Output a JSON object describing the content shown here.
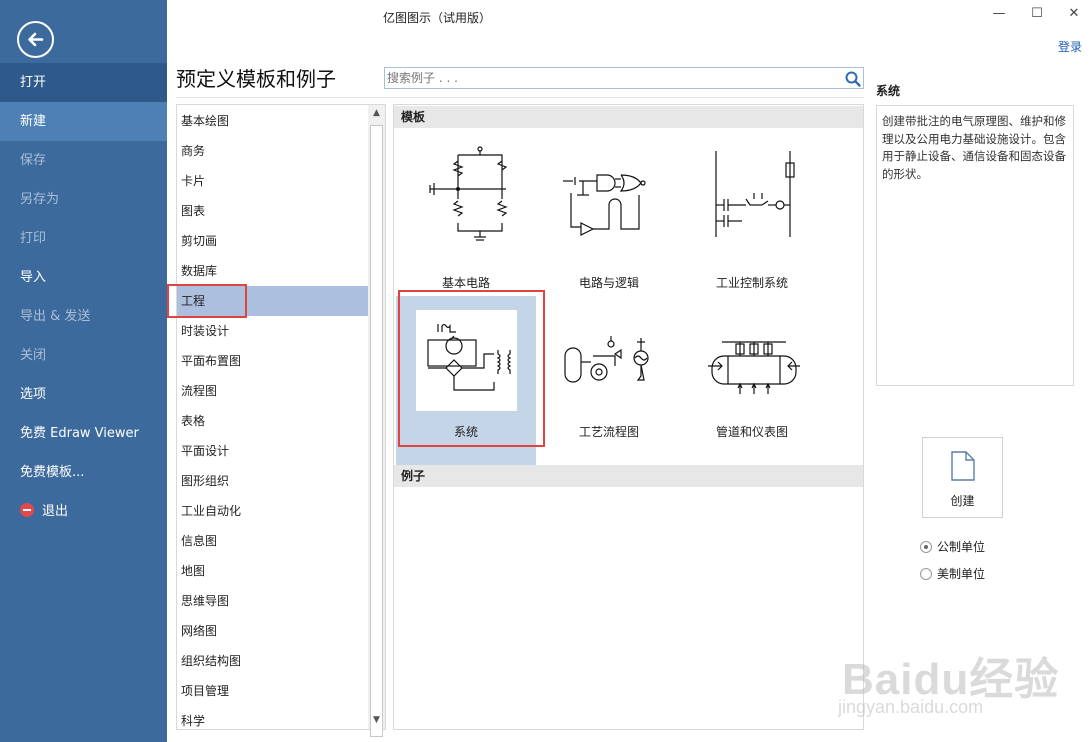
{
  "app": {
    "title": "亿图图示（试用版）",
    "login": "登录"
  },
  "window": {
    "minimize": "—",
    "maximize": "☐",
    "close": "✕"
  },
  "nav": {
    "items": [
      {
        "label": "打开",
        "state": "open"
      },
      {
        "label": "新建",
        "state": "active"
      },
      {
        "label": "保存",
        "state": "dim"
      },
      {
        "label": "另存为",
        "state": "dim"
      },
      {
        "label": "打印",
        "state": "dim"
      },
      {
        "label": "导入",
        "state": "normal"
      },
      {
        "label": "导出 & 发送",
        "state": "dim"
      },
      {
        "label": "关闭",
        "state": "dim"
      },
      {
        "label": "选项",
        "state": "normal"
      },
      {
        "label": "免费 Edraw Viewer",
        "state": "normal"
      },
      {
        "label": "免费模板...",
        "state": "normal"
      },
      {
        "label": "退出",
        "state": "normal"
      }
    ]
  },
  "main": {
    "heading": "预定义模板和例子",
    "search_placeholder": "搜索例子 . . ."
  },
  "categories": {
    "selected": "工程",
    "items": [
      "基本绘图",
      "商务",
      "卡片",
      "图表",
      "剪切画",
      "数据库",
      "工程",
      "时装设计",
      "平面布置图",
      "流程图",
      "表格",
      "平面设计",
      "图形组织",
      "工业自动化",
      "信息图",
      "地图",
      "思维导图",
      "网络图",
      "组织结构图",
      "项目管理",
      "科学"
    ]
  },
  "templates": {
    "section_title": "模板",
    "items": [
      {
        "label": "基本电路"
      },
      {
        "label": "电路与逻辑"
      },
      {
        "label": "工业控制系统"
      },
      {
        "label": "系统",
        "selected": true
      },
      {
        "label": "工艺流程图"
      },
      {
        "label": "管道和仪表图"
      }
    ]
  },
  "examples": {
    "section_title": "例子"
  },
  "details": {
    "title": "系统",
    "description": "创建带批注的电气原理图、维护和修理以及公用电力基础设施设计。包含用于静止设备、通信设备和固态设备的形状。"
  },
  "actions": {
    "create": "创建"
  },
  "units": {
    "metric": "公制单位",
    "us": "美制单位",
    "selected": "metric"
  },
  "watermark": {
    "brand": "Baidu经验",
    "url": "jingyan.baidu.com"
  },
  "colors": {
    "nav_bg": "#3d6a9c",
    "nav_active": "#4e80b5",
    "selection": "#adbfde",
    "highlight": "#e0443e"
  }
}
